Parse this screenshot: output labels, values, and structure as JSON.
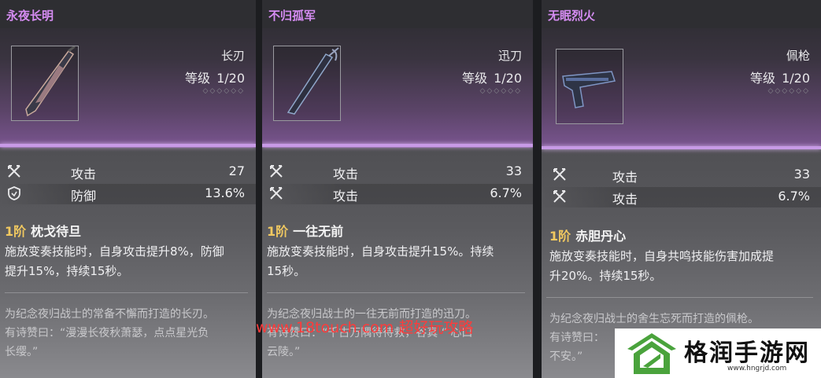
{
  "cards": [
    {
      "title": "永夜长明",
      "weapon_type": "长刃",
      "level_label": "等级",
      "level_value": "1/20",
      "stats": [
        {
          "icon": "attack-icon",
          "label": "攻击",
          "value": "27"
        },
        {
          "icon": "defense-icon",
          "label": "防御",
          "value": "13.6%"
        }
      ],
      "skill_tier": "1阶",
      "skill_name": "枕戈待旦",
      "skill_desc": [
        "施放变奏技能时，自身攻击提升8%，防御",
        "提升15%，持续15秒。"
      ],
      "lore": [
        "为纪念夜归战士的常备不懈而打造的长刃。",
        "有诗赞曰：“漫漫长夜秋萧瑟，点点星光负",
        "长缨。”"
      ]
    },
    {
      "title": "不归孤军",
      "weapon_type": "迅刀",
      "level_label": "等级",
      "level_value": "1/20",
      "stats": [
        {
          "icon": "attack-icon",
          "label": "攻击",
          "value": "33"
        },
        {
          "icon": "attack-icon",
          "label": "攻击",
          "value": "6.7%"
        }
      ],
      "skill_tier": "1阶",
      "skill_name": "一往无前",
      "skill_desc": [
        "施放变奏技能时，自身攻击提升15%。持续",
        "15秒。"
      ],
      "lore": [
        "为纪念夜归战士的一往无前而打造的迅刀。",
        "有诗赞曰：“千古万隅待待救，谷真 “ 心口",
        "云陵。”"
      ]
    },
    {
      "title": "无眠烈火",
      "weapon_type": "佩枪",
      "level_label": "等级",
      "level_value": "1/20",
      "stats": [
        {
          "icon": "attack-icon",
          "label": "攻击",
          "value": "33"
        },
        {
          "icon": "attack-icon",
          "label": "攻击",
          "value": "6.7%"
        }
      ],
      "skill_tier": "1阶",
      "skill_name": "赤胆丹心",
      "skill_desc": [
        "施放变奏技能时，自身共鸣技能伤害加成提",
        "升20%。持续15秒。"
      ],
      "lore": [
        "为纪念夜归战士的舍生忘死而打造的佩枪。",
        "有诗赞曰：",
        "不安。”"
      ]
    }
  ],
  "watermark": "www.18touch.com 超好玩攻略",
  "logo": {
    "name": "格润手游网",
    "url": "www.hngrjd.com"
  },
  "colors": {
    "title": "#d58cf2",
    "tier": "#f0c860",
    "accent_bar": "#c79ae6",
    "watermark": "#ff3b3b",
    "logo_green": "#4aa33c"
  }
}
